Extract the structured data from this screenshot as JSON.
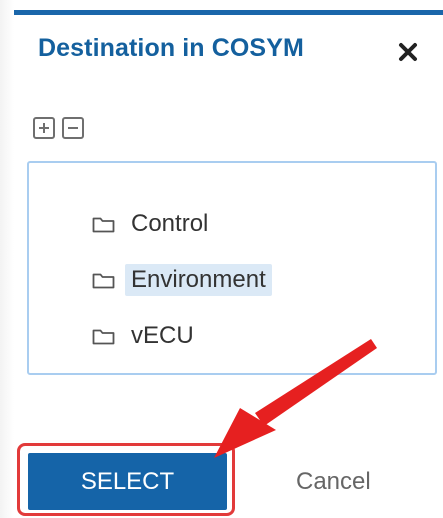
{
  "dialog": {
    "title": "Destination in COSYM",
    "close_glyph": "✕"
  },
  "toolbar": {
    "expand_icon": "plus-square-icon",
    "collapse_icon": "minus-square-icon"
  },
  "tree": {
    "items": [
      {
        "label": "Control",
        "icon": "folder-icon",
        "selected": false
      },
      {
        "label": "Environment",
        "icon": "folder-icon",
        "selected": true
      },
      {
        "label": "vECU",
        "icon": "folder-icon",
        "selected": false
      }
    ]
  },
  "actions": {
    "select_label": "SELECT",
    "cancel_label": "Cancel"
  },
  "colors": {
    "title": "#14609e",
    "primary_button": "#1564a8",
    "highlight": "#e23a3a",
    "selection": "#dbe9f6"
  }
}
